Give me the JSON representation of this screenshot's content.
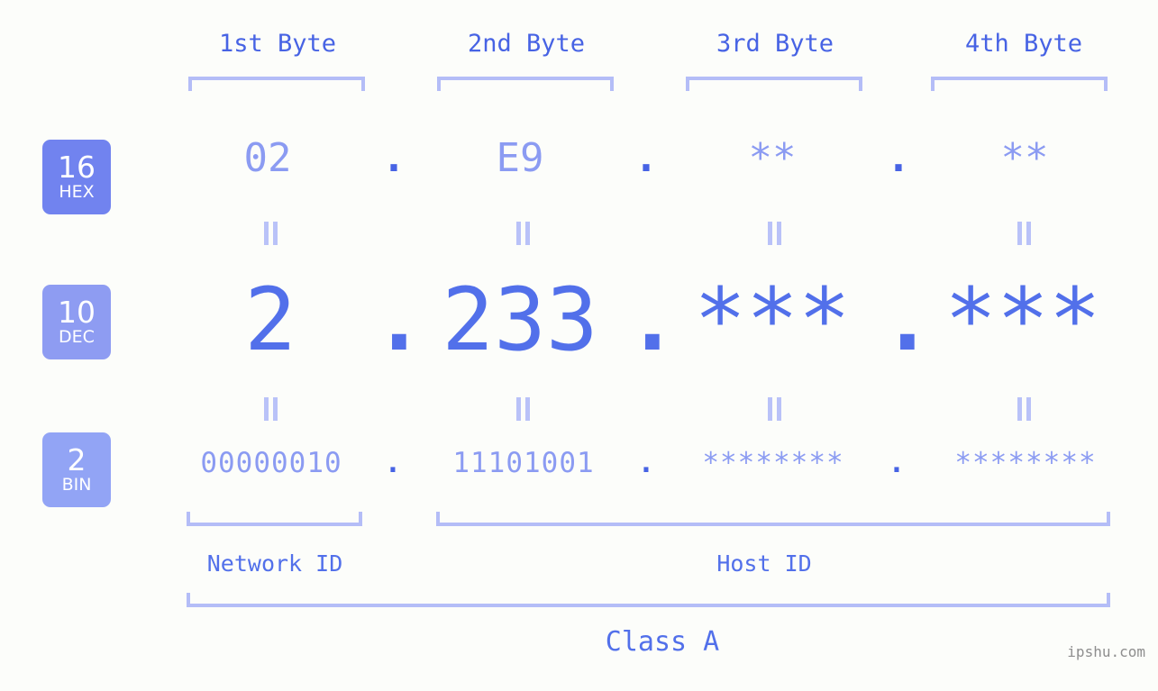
{
  "theme": {
    "background": "#fcfdfa",
    "accent_strong": "#4763e4",
    "accent_mid": "#5270ea",
    "accent_light": "#8b9bf2",
    "bracket": "#b4bdf7",
    "connector": "#b9c2f8",
    "badge_hex_bg": "#7183ef",
    "badge_dec_bg": "#8e9cf2",
    "badge_bin_bg": "#92a4f5",
    "watermark": "#8e8e8e"
  },
  "headers": {
    "byte1": "1st Byte",
    "byte2": "2nd Byte",
    "byte3": "3rd Byte",
    "byte4": "4th Byte"
  },
  "bases": [
    {
      "number": "16",
      "name": "HEX"
    },
    {
      "number": "10",
      "name": "DEC"
    },
    {
      "number": "2",
      "name": "BIN"
    }
  ],
  "separator": ".",
  "rows": {
    "hex": {
      "base_number": "16",
      "base_name": "HEX",
      "values": [
        "02",
        "E9",
        "**",
        "**"
      ]
    },
    "dec": {
      "base_number": "10",
      "base_name": "DEC",
      "values": [
        "2",
        "233",
        "***",
        "***"
      ]
    },
    "bin": {
      "base_number": "2",
      "base_name": "BIN",
      "values": [
        "00000010",
        "11101001",
        "********",
        "********"
      ]
    }
  },
  "equality_marks": {
    "hex_to_dec": "||",
    "dec_to_bin": "||"
  },
  "footer": {
    "network_id": "Network ID",
    "host_id": "Host ID",
    "class": "Class A",
    "watermark": "ipshu.com"
  }
}
